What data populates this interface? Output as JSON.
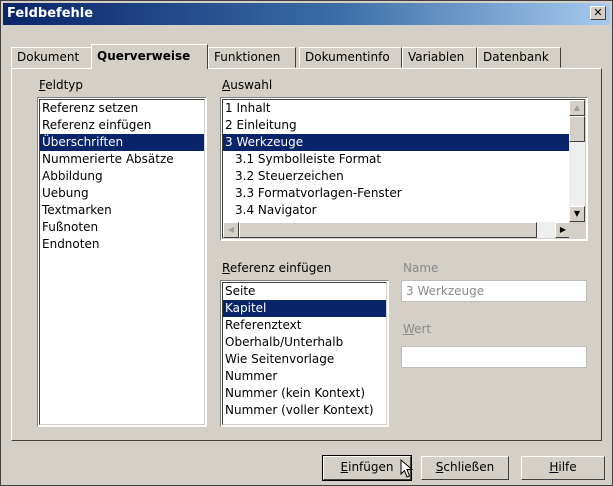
{
  "window": {
    "title": "Feldbefehle",
    "close_glyph": "✕"
  },
  "tabs": [
    {
      "label": "Dokument"
    },
    {
      "label": "Querverweise"
    },
    {
      "label": "Funktionen"
    },
    {
      "label": "Dokumentinfo"
    },
    {
      "label": "Variablen"
    },
    {
      "label": "Datenbank"
    }
  ],
  "feldtyp": {
    "label_first": "F",
    "label_rest": "eldtyp",
    "items": [
      "Referenz setzen",
      "Referenz einfügen",
      "Überschriften",
      "Nummerierte Absätze",
      "Abbildung",
      "Uebung",
      "Textmarken",
      "Fußnoten",
      "Endnoten"
    ],
    "selected_index": 2
  },
  "auswahl": {
    "label_first": "A",
    "label_rest": "uswahl",
    "items": [
      "1 Inhalt",
      "2 Einleitung",
      "3 Werkzeuge",
      "3.1 Symbolleiste Format",
      "3.2 Steuerzeichen",
      "3.3 Formatvorlagen-Fenster",
      "3.4 Navigator"
    ],
    "selected_index": 2
  },
  "referenz": {
    "label_first": "R",
    "label_rest": "eferenz einfügen",
    "items": [
      "Seite",
      "Kapitel",
      "Referenztext",
      "Oberhalb/Unterhalb",
      "Wie Seitenvorlage",
      "Nummer",
      "Nummer (kein Kontext)",
      "Nummer (voller Kontext)"
    ],
    "selected_index": 1
  },
  "name": {
    "label": "Name",
    "value": "3 Werkzeuge"
  },
  "wert": {
    "label_first": "W",
    "label_rest": "ert",
    "value": ""
  },
  "buttons": {
    "insert_first": "E",
    "insert_rest": "infügen",
    "close_first": "S",
    "close_rest": "chließen",
    "help_first": "H",
    "help_rest": "ilfe"
  },
  "icons": {
    "close": "close-icon",
    "scroll_up": "arrow-up-icon",
    "scroll_down": "arrow-down-icon",
    "scroll_left": "arrow-left-icon",
    "scroll_right": "arrow-right-icon",
    "cursor": "mouse-pointer-icon"
  },
  "colors": {
    "selection": "#0a246a",
    "titlebar": "#0a246a",
    "dialog_bg": "#d4d0c8"
  }
}
